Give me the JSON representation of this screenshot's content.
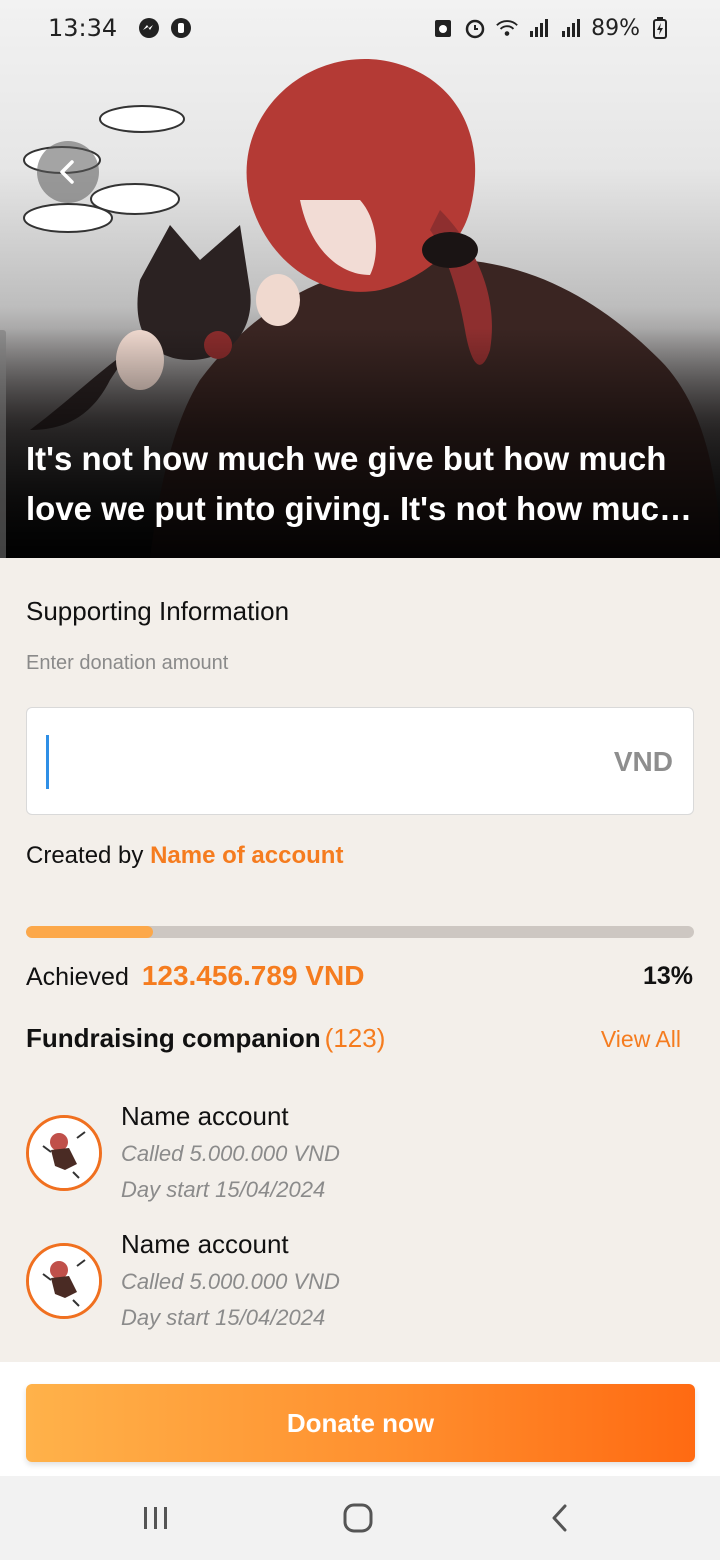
{
  "status_bar": {
    "time": "13:34",
    "battery": "89%",
    "left_icons": [
      "messenger-icon",
      "app-badge-icon"
    ],
    "right_icons": [
      "recycle-icon",
      "alarm-icon",
      "wifi-icon",
      "signal-icon",
      "signal-icon",
      "battery-charging-icon"
    ]
  },
  "hero": {
    "quote": "It's not how much we give but how much love we put into giving. It's not how much we give but how much love we put into giving."
  },
  "support": {
    "section_title": "Supporting Information",
    "input_label": "Enter donation amount",
    "amount_value": "",
    "currency": "VND"
  },
  "creator": {
    "prefix": "Created by",
    "name": "Name of account"
  },
  "progress": {
    "fraction": 0.19,
    "achieved_label": "Achieved",
    "achieved_amount": "123.456.789 VND",
    "percent_label": "13%"
  },
  "companions": {
    "title": "Fundraising companion",
    "count": "(123)",
    "view_all": "View All",
    "items": [
      {
        "name": "Name account",
        "called": "Called 5.000.000 VND",
        "day": "Day start 15/04/2024"
      },
      {
        "name": "Name account",
        "called": "Called 5.000.000 VND",
        "day": "Day start 15/04/2024"
      }
    ]
  },
  "cta": {
    "donate_label": "Donate now"
  },
  "colors": {
    "accent": "#F57C1F",
    "progress_fill": "#FCA84A",
    "caret": "#2F8FE6"
  }
}
